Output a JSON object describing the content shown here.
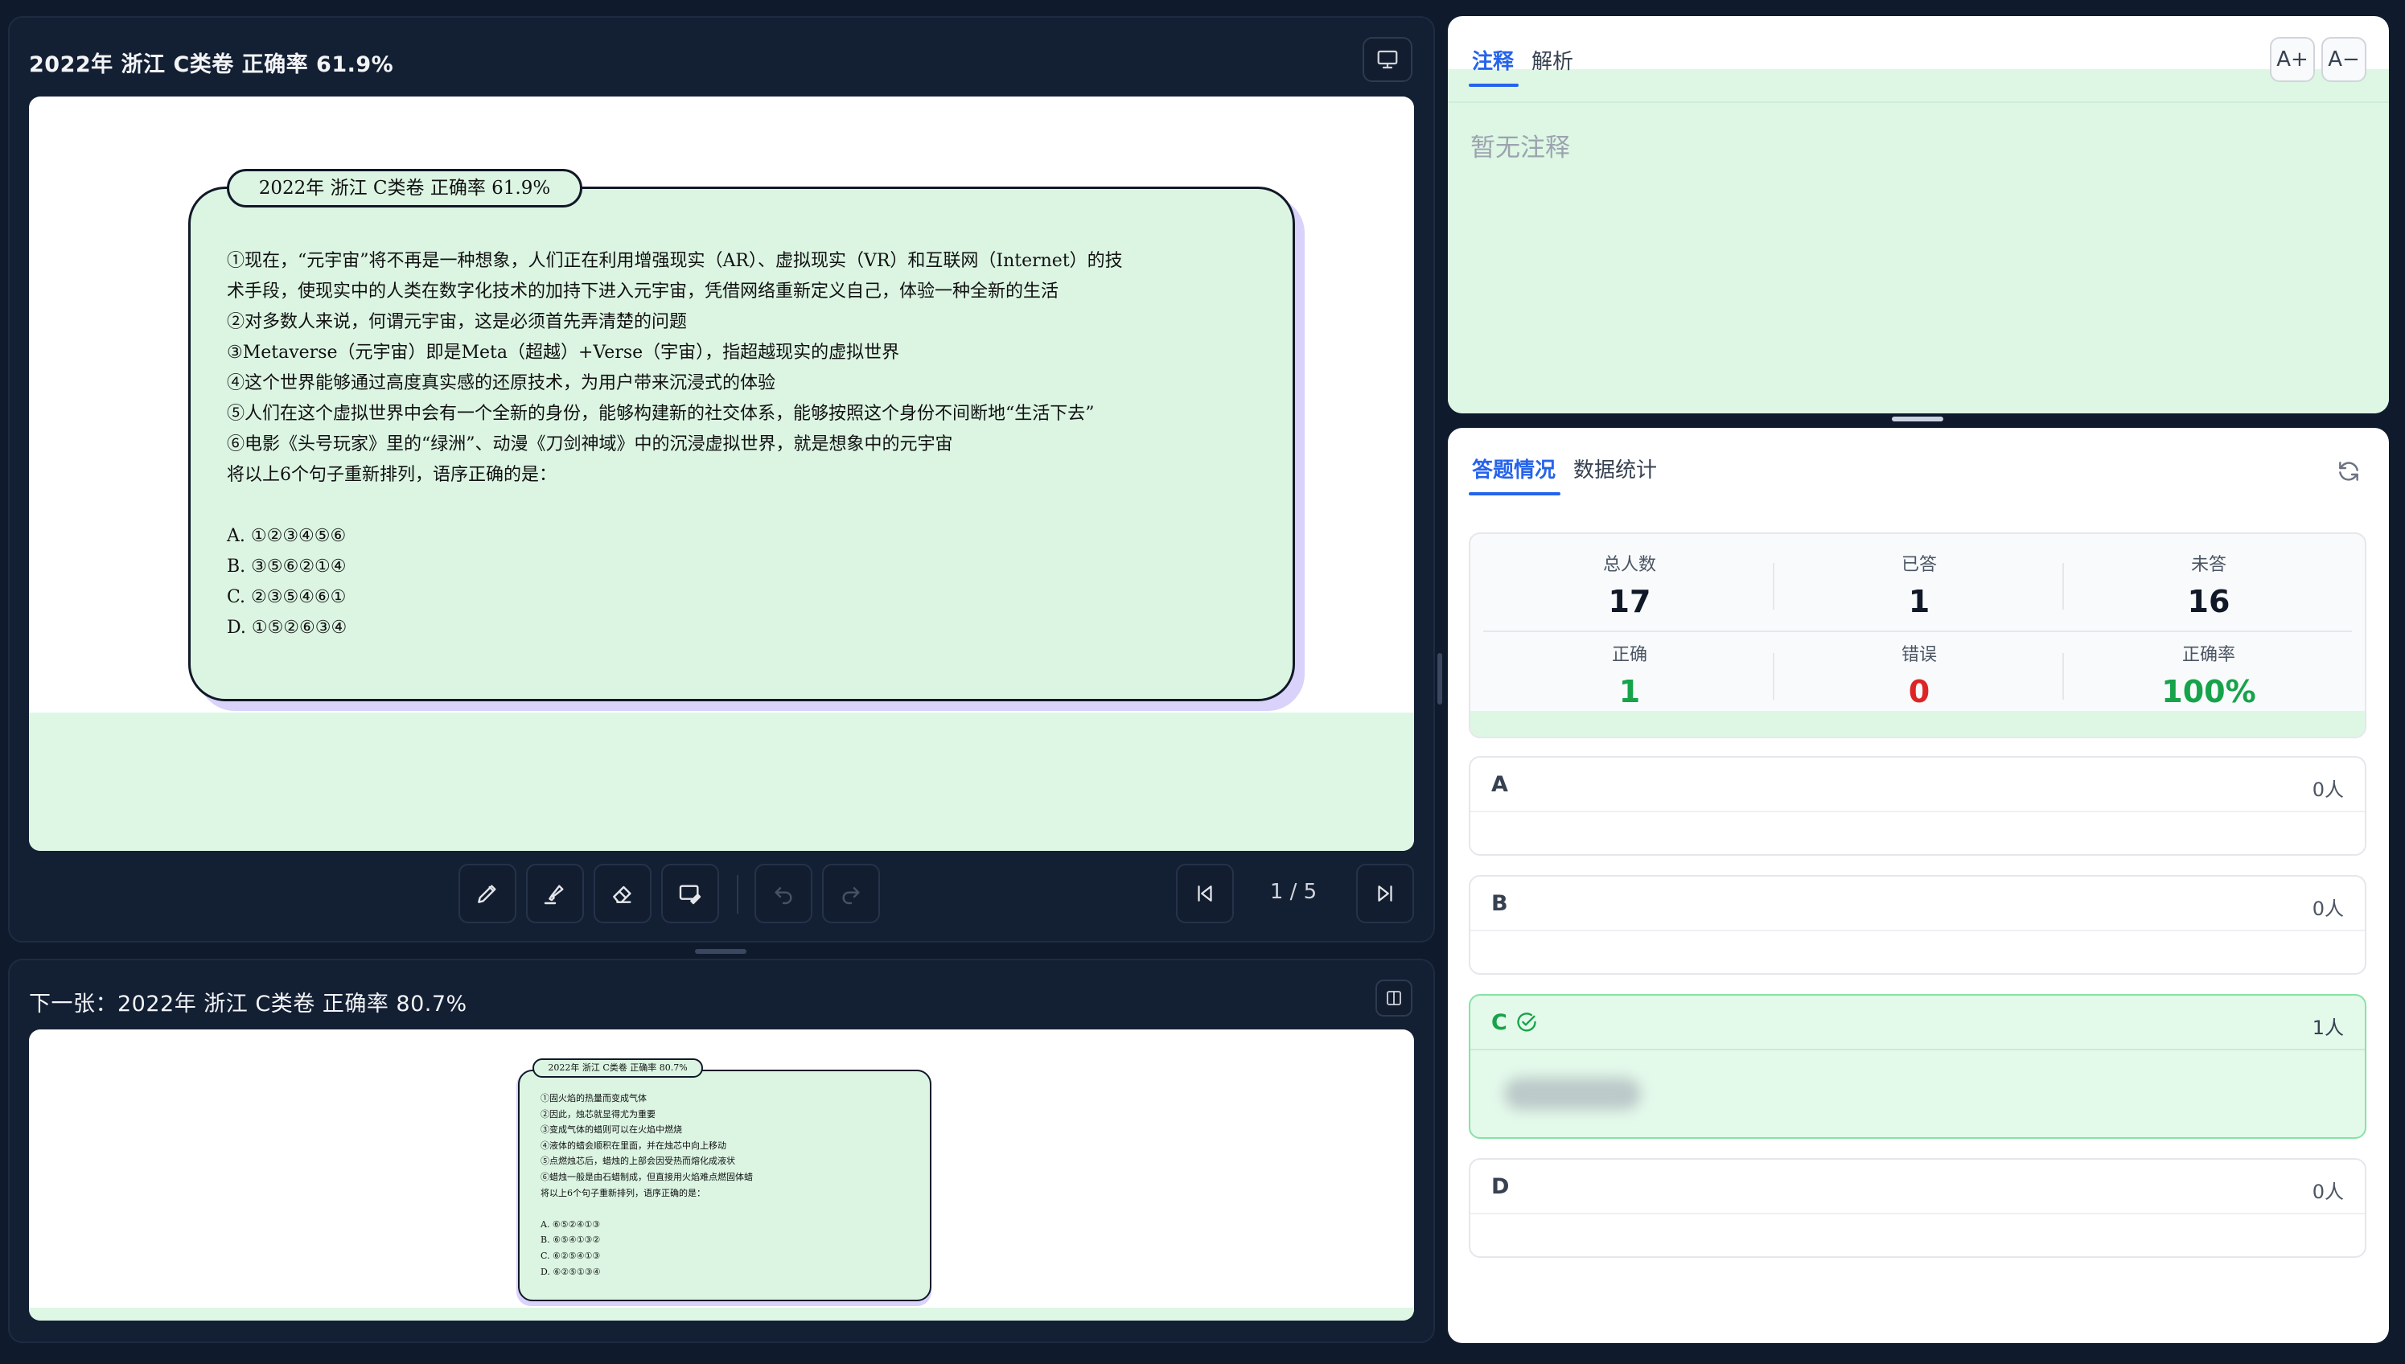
{
  "current": {
    "title": "2022年 浙江 C类卷 正确率 61.9%",
    "card": {
      "tag": "2022年 浙江 C类卷 正确率 61.9%",
      "lines": [
        "①现在，“元宇宙”将不再是一种想象，人们正在利用增强现实（AR）、虚拟现实（VR）和互联网（Internet）的技",
        "术手段，使现实中的人类在数字化技术的加持下进入元宇宙，凭借网络重新定义自己，体验一种全新的生活",
        "②对多数人来说，何谓元宇宙，这是必须首先弄清楚的问题",
        "③Metaverse（元宇宙）即是Meta（超越）+Verse（宇宙），指超越现实的虚拟世界",
        "④这个世界能够通过高度真实感的还原技术，为用户带来沉浸式的体验",
        "⑤人们在这个虚拟世界中会有一个全新的身份，能够构建新的社交体系，能够按照这个身份不间断地“生活下去”",
        "⑥电影《头号玩家》里的“绿洲”、动漫《刀剑神域》中的沉浸虚拟世界，就是想象中的元宇宙",
        "将以上6个句子重新排列，语序正确的是："
      ],
      "options": [
        "A. ①②③④⑤⑥",
        "B. ③⑤⑥②①④",
        "C. ②③⑤④⑥①",
        "D. ①⑤②⑥③④"
      ]
    }
  },
  "pagination": {
    "label": "1 / 5"
  },
  "next": {
    "title": "下一张：2022年 浙江 C类卷 正确率 80.7%",
    "card": {
      "tag": "2022年 浙江 C类卷 正确率 80.7%",
      "lines": [
        "①固火焰的热量而变成气体",
        "②因此，烛芯就显得尤为重要",
        "③变成气体的蜡则可以在火焰中燃烧",
        "④液体的蜡会顺积在里面，并在烛芯中向上移动",
        "⑤点燃烛芯后，蜡烛的上部会因受热而熔化成液状",
        "⑥蜡烛一般是由石蜡制成，但直接用火焰难点燃固体蜡",
        "将以上6个句子重新排列，语序正确的是："
      ],
      "options": [
        "A. ⑥⑤②④①③",
        "B. ⑥⑤④①③②",
        "C. ⑥②⑤④①③",
        "D. ⑥②⑤①③④"
      ]
    }
  },
  "notes": {
    "tabs": [
      "注释",
      "解析"
    ],
    "font_increase": "A+",
    "font_decrease": "A−",
    "empty_text": "暂无注释"
  },
  "answers": {
    "tabs": [
      "答题情况",
      "数据统计"
    ],
    "stats": [
      {
        "label": "总人数",
        "value": "17"
      },
      {
        "label": "已答",
        "value": "1"
      },
      {
        "label": "未答",
        "value": "16"
      },
      {
        "label": "正确",
        "value": "1"
      },
      {
        "label": "错误",
        "value": "0"
      },
      {
        "label": "正确率",
        "value": "100%"
      }
    ],
    "options": [
      {
        "letter": "A",
        "count": "0人"
      },
      {
        "letter": "B",
        "count": "0人"
      },
      {
        "letter": "C",
        "count": "1人"
      },
      {
        "letter": "D",
        "count": "0人"
      }
    ]
  },
  "colors": {
    "accent": "#2563eb",
    "correct": "#16a34a",
    "wrong": "#dc2626",
    "card_bg": "#dcf5e3",
    "card_shadow": "#d9d2fb"
  }
}
